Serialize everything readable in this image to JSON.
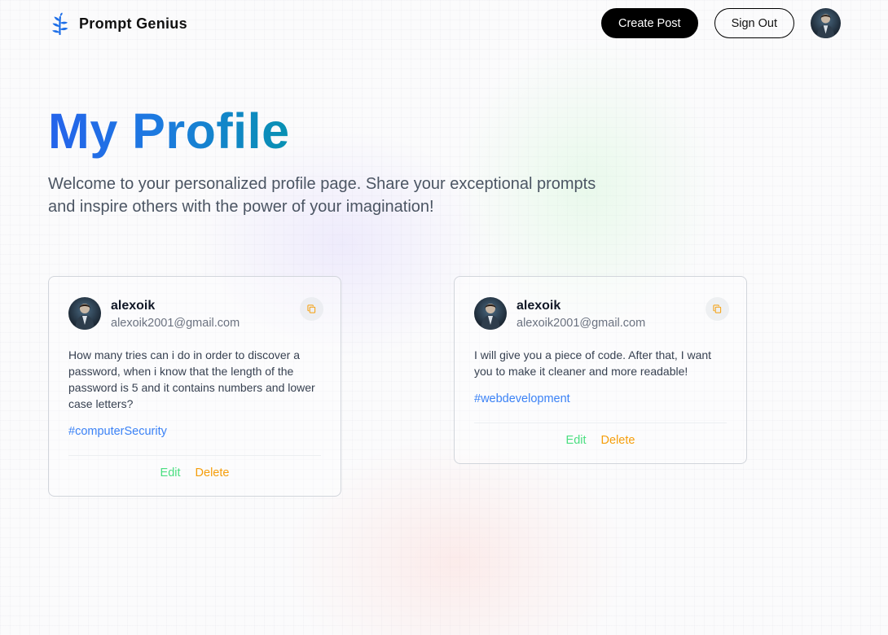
{
  "nav": {
    "brand_name": "Prompt Genius",
    "logo_icon": "leaf-sprig-icon",
    "create_post_label": "Create Post",
    "sign_out_label": "Sign Out",
    "avatar_icon": "user-avatar-photo"
  },
  "header": {
    "title": "My Profile",
    "description": "Welcome to your personalized profile page. Share your exceptional prompts and inspire others with the power of your imagination!"
  },
  "posts": [
    {
      "username": "alexoik",
      "email": "alexoik2001@gmail.com",
      "prompt": "How many tries can i do in order to discover a password, when i know that the length of the password is 5 and it contains numbers and lower case letters?",
      "tag": "#computerSecurity",
      "edit_label": "Edit",
      "delete_label": "Delete",
      "copy_icon": "copy-icon"
    },
    {
      "username": "alexoik",
      "email": "alexoik2001@gmail.com",
      "prompt": "I will give you a piece of code. After that, I want you to make it cleaner and more readable!",
      "tag": "#webdevelopment",
      "edit_label": "Edit",
      "delete_label": "Delete",
      "copy_icon": "copy-icon"
    }
  ],
  "colors": {
    "title_gradient_start": "#2563eb",
    "title_gradient_end": "#0891b2",
    "tag": "#3b82f6",
    "edit": "#4ade80",
    "delete": "#f59e0b",
    "primary_button": "#000000"
  }
}
